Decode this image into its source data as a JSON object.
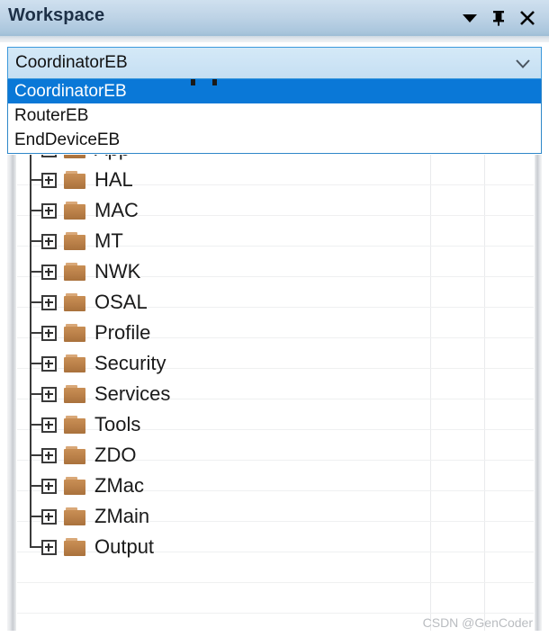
{
  "window": {
    "title": "Workspace",
    "controls": [
      {
        "name": "menu-dropdown-button",
        "icon": "chevron-down-filled-icon",
        "glyph": "▼"
      },
      {
        "name": "pin-button",
        "icon": "pin-icon",
        "glyph": "丬"
      },
      {
        "name": "close-button",
        "icon": "close-icon",
        "glyph": "✕"
      }
    ]
  },
  "combobox": {
    "name": "project-configuration-combobox",
    "value": "CoordinatorEB",
    "placeholder": "CoordinatorEB",
    "chevron_icon": "chevron-down-icon",
    "expanded": true,
    "options": [
      {
        "label": "CoordinatorEB",
        "selected": true
      },
      {
        "label": "RouterEB",
        "selected": false
      },
      {
        "label": "EndDeviceEB",
        "selected": false
      }
    ]
  },
  "tree": {
    "name": "workspace-file-tree",
    "expand_icon": "plus-box-icon",
    "folder_icon": "folder-icon",
    "nodes": [
      {
        "label": "App"
      },
      {
        "label": "HAL"
      },
      {
        "label": "MAC"
      },
      {
        "label": "MT"
      },
      {
        "label": "NWK"
      },
      {
        "label": "OSAL"
      },
      {
        "label": "Profile"
      },
      {
        "label": "Security"
      },
      {
        "label": "Services"
      },
      {
        "label": "Tools"
      },
      {
        "label": "ZDO"
      },
      {
        "label": "ZMac"
      },
      {
        "label": "ZMain"
      },
      {
        "label": "Output"
      }
    ]
  },
  "watermark": {
    "text": "CSDN @GenCoder"
  },
  "colors": {
    "titlebar_top": "#cfe0ef",
    "titlebar_bottom": "#9fbdd6",
    "title_text": "#1d3047",
    "combobox_border": "#3c99dc",
    "combobox_bg": "#cde4f5",
    "selection_blue": "#0a78d7",
    "folder_brown": "#b97f48",
    "grid_line": "#e9eaec",
    "watermark": "#b9bcc0"
  }
}
